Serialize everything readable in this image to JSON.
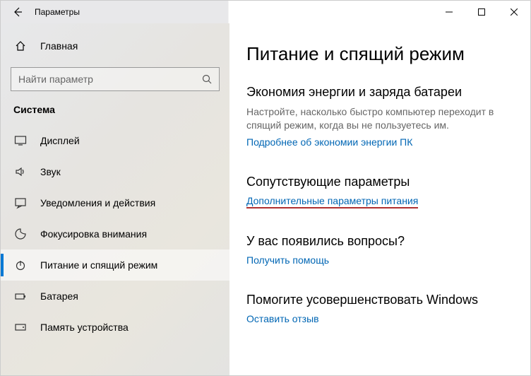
{
  "titlebar": {
    "title": "Параметры"
  },
  "sidebar": {
    "home": "Главная",
    "search_placeholder": "Найти параметр",
    "group": "Система",
    "items": [
      {
        "label": "Дисплей"
      },
      {
        "label": "Звук"
      },
      {
        "label": "Уведомления и действия"
      },
      {
        "label": "Фокусировка внимания"
      },
      {
        "label": "Питание и спящий режим"
      },
      {
        "label": "Батарея"
      },
      {
        "label": "Память устройства"
      }
    ]
  },
  "content": {
    "page_title": "Питание и спящий режим",
    "s1": {
      "heading": "Экономия энергии и заряда батареи",
      "desc": "Настройте, насколько быстро компьютер переходит в спящий режим, когда вы не пользуетесь им.",
      "link": "Подробнее об экономии энергии ПК"
    },
    "s2": {
      "heading": "Сопутствующие параметры",
      "link": "Дополнительные параметры питания"
    },
    "s3": {
      "heading": "У вас появились вопросы?",
      "link": "Получить помощь"
    },
    "s4": {
      "heading": "Помогите усовершенствовать Windows",
      "link": "Оставить отзыв"
    }
  }
}
